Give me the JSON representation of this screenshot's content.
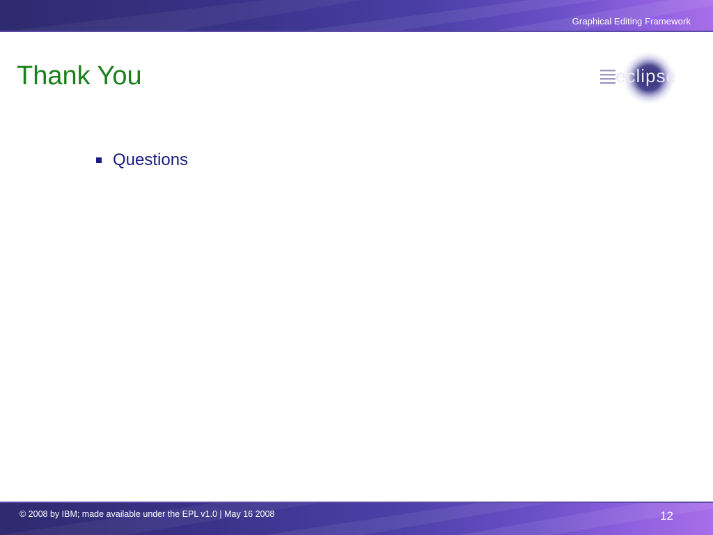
{
  "header": {
    "title": "Graphical Editing Framework"
  },
  "slide": {
    "title": "Thank You",
    "bullets": [
      "Questions"
    ]
  },
  "logo": {
    "text": "eclipse",
    "icon": "eclipse-logo-icon"
  },
  "footer": {
    "copyright": "© 2008 by IBM; made available under the EPL v1.0 | May 16 2008",
    "page_number": "12"
  },
  "colors": {
    "title": "#1b7f1b",
    "bullet_text": "#1a1a80",
    "band_dark": "#2e2a6e",
    "band_light": "#a86ee8"
  }
}
